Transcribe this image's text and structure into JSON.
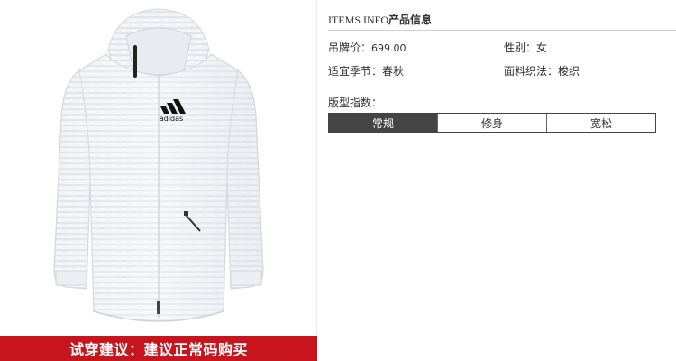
{
  "banner": {
    "text": "试穿建议：建议正常码购买"
  },
  "logo": {
    "brand_text": "adidas"
  },
  "info": {
    "title_en": "ITEMS INFO",
    "title_cn": "产品信息",
    "price_label": "吊牌价：",
    "price_value": "699.00",
    "gender_label": "性别：",
    "gender_value": "女",
    "season_label": "适宜季节：",
    "season_value": "春秋",
    "fabric_label": "面料织法：",
    "fabric_value": "梭织"
  },
  "fit": {
    "label": "版型指数：",
    "options": [
      "常规",
      "修身",
      "宽松"
    ],
    "selected": "常规"
  },
  "colors": {
    "banner": "#c8141c",
    "active_cell": "#444444"
  }
}
